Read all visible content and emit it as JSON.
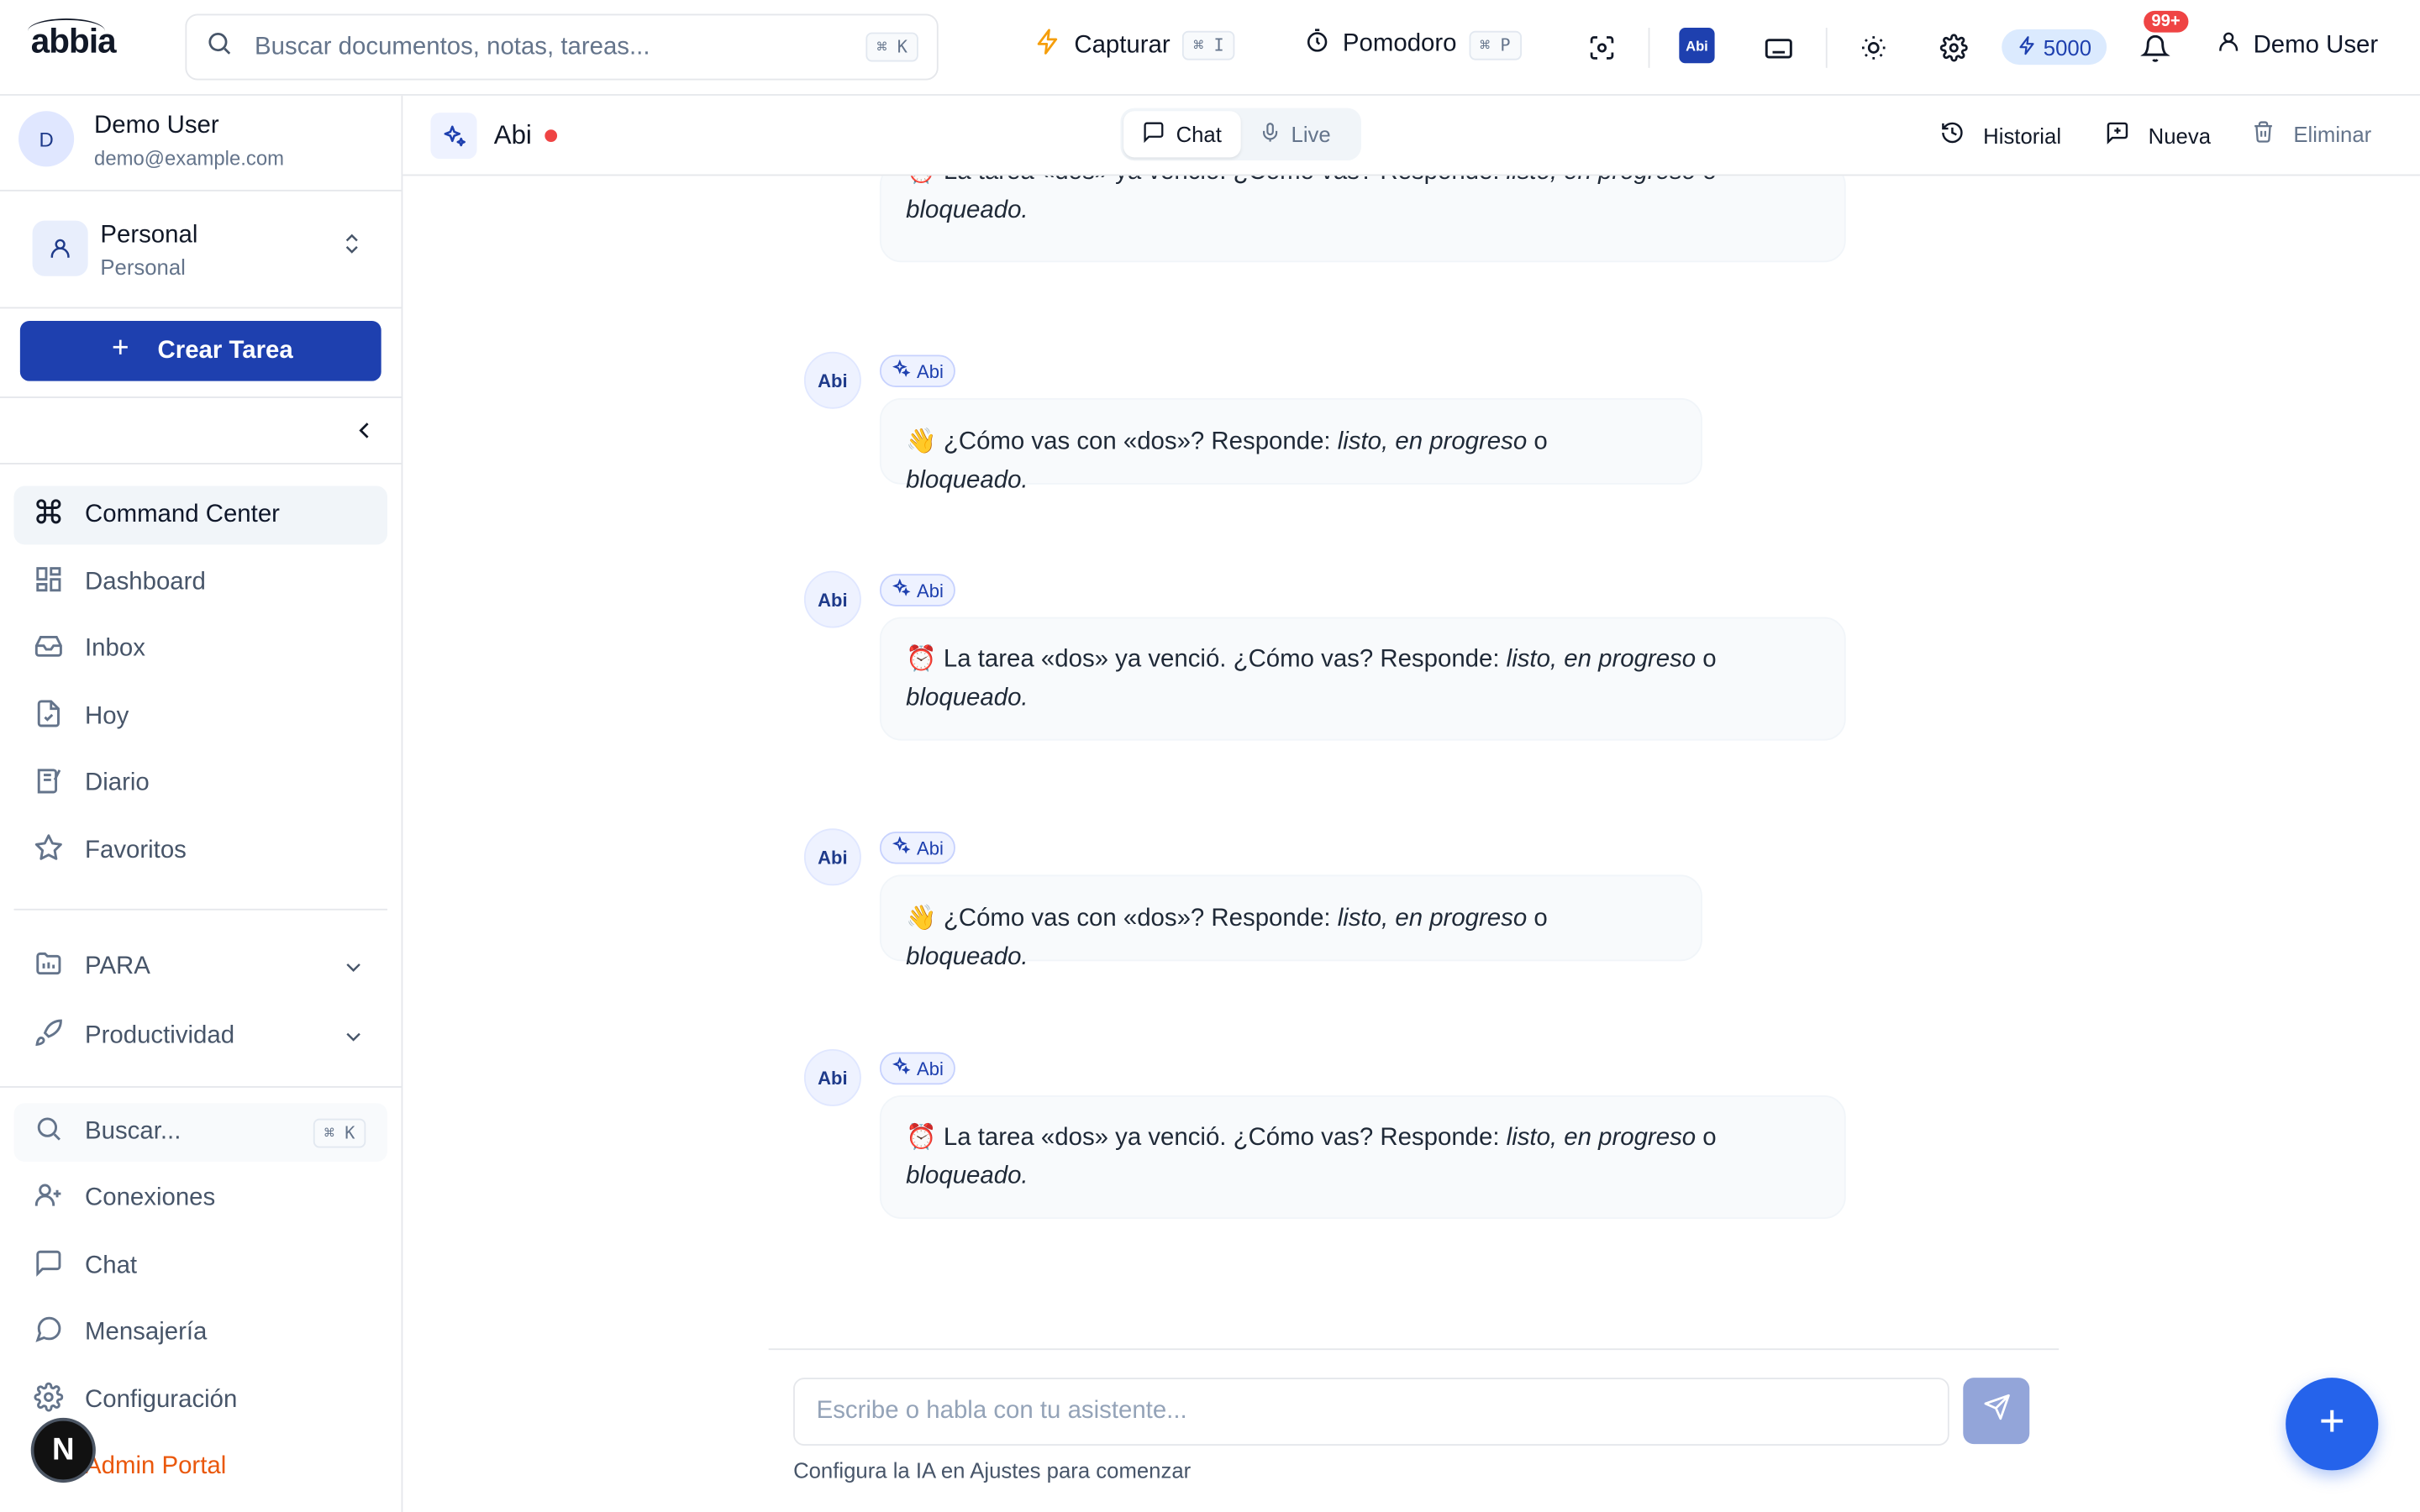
{
  "app": {
    "logo_text": "abbia"
  },
  "topbar": {
    "search_placeholder": "Buscar documentos, notas, tareas...",
    "search_shortcut": "⌘ K",
    "capture_label": "Capturar",
    "capture_shortcut": "⌘ I",
    "pomodoro_label": "Pomodoro",
    "pomodoro_shortcut": "⌘ P",
    "abi_chip": "Abi",
    "credits": "5000",
    "notif_badge": "99+",
    "user_name": "Demo User"
  },
  "sidebar": {
    "user": {
      "initial": "D",
      "name": "Demo User",
      "email": "demo@example.com"
    },
    "workspace": {
      "name": "Personal",
      "sub": "Personal"
    },
    "create_label": "Crear Tarea",
    "nav": [
      {
        "label": "Command Center",
        "icon": "command-icon",
        "active": true
      },
      {
        "label": "Dashboard",
        "icon": "dashboard-icon"
      },
      {
        "label": "Inbox",
        "icon": "inbox-icon"
      },
      {
        "label": "Hoy",
        "icon": "today-icon"
      },
      {
        "label": "Diario",
        "icon": "journal-icon"
      },
      {
        "label": "Favoritos",
        "icon": "star-icon"
      }
    ],
    "groups": [
      {
        "label": "PARA",
        "icon": "folder-icon"
      },
      {
        "label": "Productividad",
        "icon": "rocket-icon"
      }
    ],
    "bottom": [
      {
        "label": "Buscar...",
        "icon": "search-icon",
        "shortcut": "⌘ K"
      },
      {
        "label": "Conexiones",
        "icon": "user-plus-icon"
      },
      {
        "label": "Chat",
        "icon": "chat-icon"
      },
      {
        "label": "Mensajería",
        "icon": "message-circle-icon"
      },
      {
        "label": "Configuración",
        "icon": "gear-icon"
      },
      {
        "label": "Admin Portal",
        "icon": "shield-icon"
      }
    ],
    "n_badge": "N"
  },
  "chat": {
    "assistant_name": "Abi",
    "tabs": [
      "Chat",
      "Live"
    ],
    "actions": {
      "history": "Historial",
      "new": "Nueva",
      "delete": "Eliminar"
    },
    "messages": [
      {
        "emoji": "⏰",
        "parts": [
          "La tarea «dos» ya venció. ¿Cómo vas? Responde: ",
          "listo, en progreso",
          " o ",
          "bloqueado."
        ]
      },
      {
        "emoji": "👋",
        "parts": [
          "¿Cómo vas con «dos»? Responde: ",
          "listo, en progreso",
          " o ",
          "bloqueado."
        ]
      },
      {
        "emoji": "⏰",
        "parts": [
          "La tarea «dos» ya venció. ¿Cómo vas? Responde: ",
          "listo, en progreso",
          " o ",
          "bloqueado."
        ]
      },
      {
        "emoji": "👋",
        "parts": [
          "¿Cómo vas con «dos»? Responde: ",
          "listo, en progreso",
          " o ",
          "bloqueado."
        ]
      },
      {
        "emoji": "⏰",
        "parts": [
          "La tarea «dos» ya venció. ¿Cómo vas? Responde: ",
          "listo, en progreso",
          " o ",
          "bloqueado."
        ]
      }
    ],
    "avatar_label": "Abi",
    "tag_label": "Abi",
    "composer_placeholder": "Escribe o habla con tu asistente...",
    "composer_hint": "Configura la IA en Ajustes para comenzar"
  },
  "colors": {
    "primary": "#1e40af",
    "accent": "#2563eb",
    "danger": "#ef4444",
    "admin": "#ea580c"
  }
}
